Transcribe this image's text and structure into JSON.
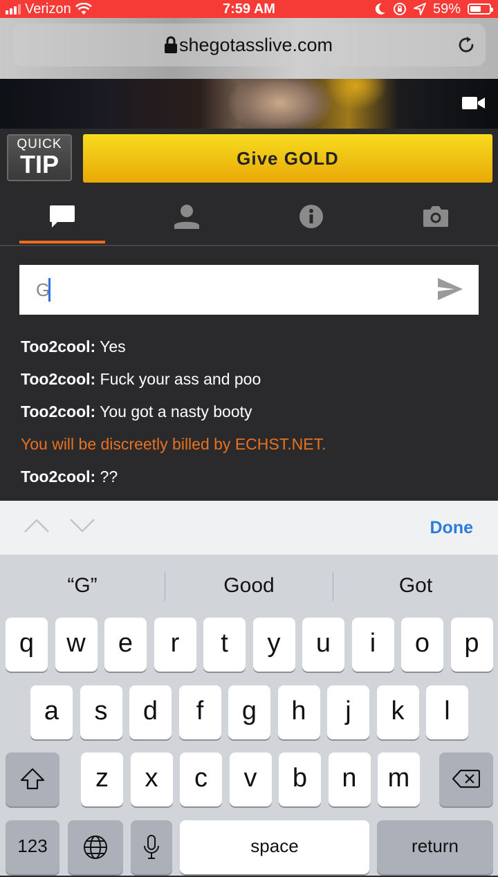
{
  "status_bar": {
    "carrier": "Verizon",
    "time": "7:59 AM",
    "battery": "59%",
    "battery_level": 0.59
  },
  "browser": {
    "url": "shegotasslive.com"
  },
  "tip_bar": {
    "quick_label": "QUICK",
    "tip_label": "TIP",
    "give_gold_label": "Give GOLD"
  },
  "tabs": [
    {
      "icon": "chat-bubble-icon",
      "active": true
    },
    {
      "icon": "user-icon",
      "active": false
    },
    {
      "icon": "info-icon",
      "active": false
    },
    {
      "icon": "camera-icon",
      "active": false
    }
  ],
  "chat": {
    "input_value": "G",
    "messages": [
      {
        "user": "Too2cool:",
        "text": " Yes"
      },
      {
        "user": "Too2cool:",
        "text": " Fuck your ass and poo"
      },
      {
        "user": "Too2cool:",
        "text": " You got a nasty booty"
      },
      {
        "system": "You will be discreetly billed by ECHST.NET."
      },
      {
        "user": "Too2cool:",
        "text": " ??"
      }
    ]
  },
  "accessory": {
    "done_label": "Done"
  },
  "keyboard": {
    "suggestions": [
      "“G”",
      "Good",
      "Got"
    ],
    "row1": [
      "q",
      "w",
      "e",
      "r",
      "t",
      "y",
      "u",
      "i",
      "o",
      "p"
    ],
    "row2": [
      "a",
      "s",
      "d",
      "f",
      "g",
      "h",
      "j",
      "k",
      "l"
    ],
    "row3": [
      "z",
      "x",
      "c",
      "v",
      "b",
      "n",
      "m"
    ],
    "numbers_label": "123",
    "space_label": "space",
    "return_label": "return"
  }
}
